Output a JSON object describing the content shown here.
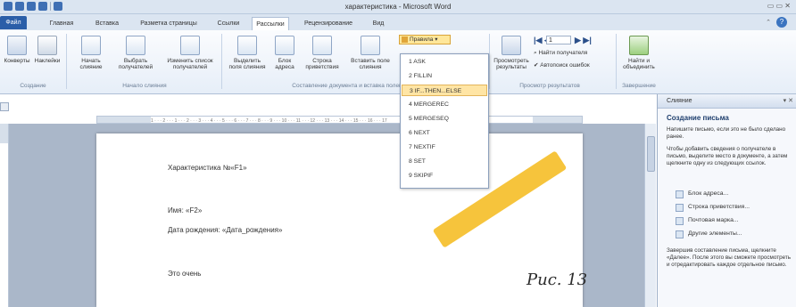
{
  "window": {
    "title": "характеристика - Microsoft Word",
    "controls": "▭ ▭ ✕"
  },
  "tabs": [
    {
      "label": "Файл"
    },
    {
      "label": "Главная"
    },
    {
      "label": "Вставка"
    },
    {
      "label": "Разметка страницы"
    },
    {
      "label": "Ссылки"
    },
    {
      "label": "Рассылки"
    },
    {
      "label": "Рецензирование"
    },
    {
      "label": "Вид"
    }
  ],
  "ribbon": {
    "create": {
      "envelopes": "Конверты",
      "labels": "Наклейки",
      "group": "Создание"
    },
    "start": {
      "start_merge": "Начать слияние",
      "select_recipients": "Выбрать получателей",
      "edit_list": "Изменить список получателей",
      "group": "Начало слияния"
    },
    "write": {
      "highlight": "Выделить поля слияния",
      "address_block": "Блок адреса",
      "greeting_line": "Строка приветствия",
      "insert_field": "Вставить поле слияния",
      "group": "Составление документа и вставка полей"
    },
    "rules_button": "Правила",
    "preview": {
      "preview_results": "Просмотреть результаты",
      "record": "1",
      "find_recipient": "Найти получателя",
      "auto_check": "Автопоиск ошибок",
      "group": "Просмотр результатов"
    },
    "finish": {
      "finish_merge": "Найти и объединить",
      "group": "Завершение"
    }
  },
  "rules_menu": [
    {
      "label": "1 ASK"
    },
    {
      "label": "2 FILLIN"
    },
    {
      "label": "3 IF...THEN...ELSE"
    },
    {
      "label": "4 MERGEREC"
    },
    {
      "label": "5 MERGESEQ"
    },
    {
      "label": "6 NEXT"
    },
    {
      "label": "7 NEXTIF"
    },
    {
      "label": "8 SET"
    },
    {
      "label": "9 SKIPIF"
    }
  ],
  "ruler": {
    "ticks": "1 · · · 2 · · · 1 · · · 2 · · · 3 · · · 4 · · · 5 · · · 6 · · · 7 · · · 8 · · · 9 · · · 10 · · · 11 · · · 12 · · · 13 · · · 14 · · · 15 · · · 16 · · · 17"
  },
  "document": {
    "line1": "Характеристика №«F1»",
    "line2": "Имя: «F2»",
    "line3": "Дата рождения: «Дата_рождения»",
    "line4": "Это очень"
  },
  "task_pane": {
    "title": "Слияние",
    "subtitle": "Создание письма",
    "intro": "Напишите письмо, если это не было сделано ранее.",
    "instructions": "Чтобы добавить сведения о получателе в письмо, выделите место в документе, а затем щелкните одну из следующих ссылок.",
    "links": [
      {
        "label": "Блок адреса..."
      },
      {
        "label": "Строка приветствия..."
      },
      {
        "label": "Почтовая марка..."
      },
      {
        "label": "Другие элементы..."
      }
    ],
    "finish_text": "Завершив составление письма, щелкните «Далее». После этого вы сможете просмотреть и отредактировать каждое отдельное письмо."
  },
  "caption": "Рис. 13",
  "colors": {
    "highlight": "#f6c132",
    "menu_hover": "#ffe5a5",
    "ribbon_bg": "#dbe5f1"
  }
}
